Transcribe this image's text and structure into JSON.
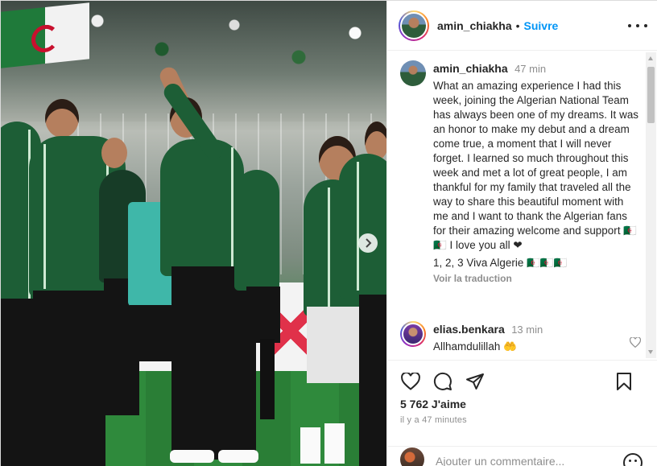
{
  "post": {
    "username": "amin_chiakha",
    "separator": "•",
    "follow_label": "Suivre",
    "more_icon": "more-horizontal-icon"
  },
  "caption": {
    "username": "amin_chiakha",
    "time": "47 min",
    "text": "What an amazing experience I had this week, joining the Algerian National Team has always been one of my dreams. It was an honor to make my debut and a dream come true, a moment that I will never forget. I learned so much throughout this week and met a lot of great people, I am thankful for my family that traveled all the way to share this beautiful moment with me and I want to thank the Algerian fans for their amazing welcome and support 🇩🇿🇩🇿 I love you all ❤",
    "text2": "1, 2, 3 Viva Algerie 🇩🇿🇩🇿🇩🇿",
    "translate_label": "Voir la traduction"
  },
  "comments": [
    {
      "username": "elias.benkara",
      "time": "13 min",
      "text": "Allhamdulillah 🤲"
    }
  ],
  "stats": {
    "likes": "5 762 J'aime",
    "posted_ago": "il y a 47 minutes"
  },
  "composer": {
    "placeholder": "Ajouter un commentaire..."
  },
  "icons": {
    "like": "heart-icon",
    "comment": "comment-icon",
    "share": "send-icon",
    "save": "bookmark-icon",
    "next": "chevron-right-icon",
    "emoji": "emoji-icon"
  },
  "colors": {
    "accent": "#0095f6",
    "text": "#262626",
    "muted": "#8e8e8e"
  }
}
